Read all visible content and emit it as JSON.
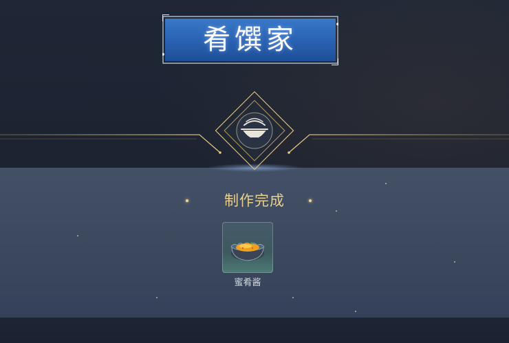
{
  "title": "肴馔家",
  "result": {
    "status_text": "制作完成"
  },
  "reward_item": {
    "name": "蜜肴酱",
    "icon": "bowl-of-sauce-icon"
  },
  "emblem": {
    "icon": "covered-dish-icon"
  },
  "colors": {
    "title_plate": "#2a63b3",
    "gold_accent": "#d9bd7a",
    "status_text": "#e9cf8e",
    "panel": "#3e4b60"
  }
}
